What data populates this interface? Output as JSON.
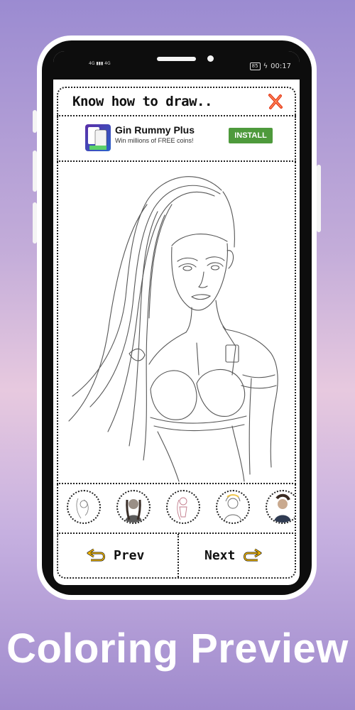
{
  "status_bar": {
    "left_indicators": "4G ▮▮▮ 4G",
    "battery": "85",
    "time": "00:17"
  },
  "header": {
    "title": "Know how to draw..",
    "close_icon": "close-x-icon"
  },
  "ad": {
    "app_name": "Gin Rummy Plus",
    "tagline": "Win millions of FREE coins!",
    "install_label": "INSTALL",
    "install_color": "#4e9a3c"
  },
  "drawing": {
    "subject": "pencil-sketch-girl-portrait"
  },
  "thumbnails": [
    {
      "name": "thumb-1"
    },
    {
      "name": "thumb-2"
    },
    {
      "name": "thumb-3"
    },
    {
      "name": "thumb-4"
    },
    {
      "name": "thumb-5"
    }
  ],
  "nav": {
    "prev_label": "Prev",
    "next_label": "Next",
    "arrow_color": "#f5b800"
  },
  "promo_caption": "Coloring Preview"
}
